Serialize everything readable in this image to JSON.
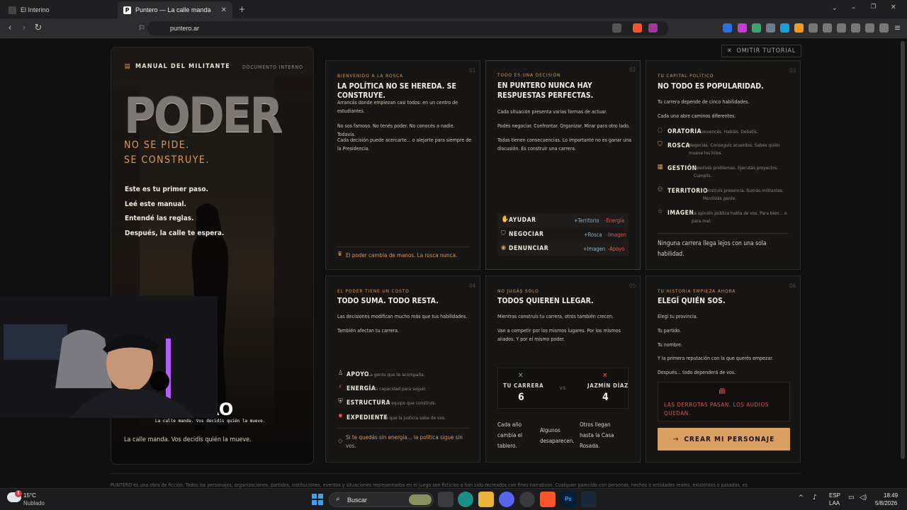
{
  "browser": {
    "tabs": [
      {
        "label": "El Interino"
      },
      {
        "label": "Puntero — La calle manda"
      }
    ],
    "url": "puntero.ar"
  },
  "skip_button": "OMITIR TUTORIAL",
  "manual": {
    "header": "MANUAL DEL MILITANTE",
    "doc_label": "DOCUMENTO INTERNO",
    "big_word": "PODER",
    "tagline_1": "NO SE PIDE.",
    "tagline_2": "SE CONSTRUYE.",
    "lines": [
      "Este es tu primer paso.",
      "Leé este manual.",
      "Entendé las reglas.",
      "Después, la calle te espera."
    ],
    "logo_text": "ERO",
    "logo_sub": "La calle manda. Vos decidís quién la mueve.",
    "footer": "La calle manda. Vos decidís quién la mueve."
  },
  "cards": {
    "c1": {
      "kicker": "BIENVENIDO A LA ROSCA",
      "num": "01",
      "title": "LA POLÍTICA NO SE HEREDA. SE CONSTRUYE.",
      "paras": [
        "Arrancás donde empiezan casi todos: en un centro de estudiantes.",
        "No sos famoso. No tenés poder. No conocés a nadie. Todavía.",
        "Cada decisión puede acercarte... o alejarte para siempre de la Presidencia."
      ],
      "footer": "El poder cambia de manos. La rosca nunca."
    },
    "c2": {
      "kicker": "TODO ES UNA DECISIÓN",
      "num": "02",
      "title_1": "EN PUNTERO NUNCA HAY",
      "title_2": "RESPUESTAS PERFECTAS.",
      "paras": [
        "Cada situación presenta varias formas de actuar.",
        "Podés negociar. Confrontar. Organizar. Mirar para otro lado.",
        "Todas tienen consecuencias. Lo importante no es ganar una discusión. Es construir una carrera."
      ],
      "actions": [
        {
          "name": "AYUDAR",
          "plus": "+Territorio",
          "minus": "-Energía"
        },
        {
          "name": "NEGOCIAR",
          "plus": "+Rosca",
          "minus": "-Imagen"
        },
        {
          "name": "DENUNCIAR",
          "plus": "+Imagen",
          "minus": "-Apoyo"
        }
      ]
    },
    "c3": {
      "kicker": "TU CAPITAL POLÍTICO",
      "num": "03",
      "title": "NO TODO ES POPULARIDAD.",
      "paras": [
        "Tu carrera depende de cinco habilidades.",
        "Cada una abre caminos diferentes."
      ],
      "skills": [
        {
          "name": "ORATORIA",
          "desc": "Convencés. Hablás. Debatís."
        },
        {
          "name": "ROSCA",
          "desc": "Negociás. Conseguís acuerdos. Sabés quién mueve los hilos."
        },
        {
          "name": "GESTIÓN",
          "desc": "Resolvés problemas. Ejecutás proyectos. Cumplís."
        },
        {
          "name": "TERRITORIO",
          "desc": "Construís presencia. Sumás militantes. Movilizás gente."
        },
        {
          "name": "IMAGEN",
          "desc": "La opinión pública habla de vos. Para bien... o para mal."
        }
      ],
      "footer": "Ninguna carrera llega lejos con una sola habilidad."
    },
    "c4": {
      "kicker": "EL PODER TIENE UN COSTO",
      "num": "04",
      "title": "TODO SUMA. TODO RESTA.",
      "paras": [
        "Las decisiones modifican mucho más que tus habilidades.",
        "También afectan tu carrera."
      ],
      "stats": [
        {
          "name": "APOYO",
          "desc": "La gente que te acompaña."
        },
        {
          "name": "ENERGÍA",
          "desc": "Tu capacidad para seguir."
        },
        {
          "name": "ESTRUCTURA",
          "desc": "El equipo que construís."
        },
        {
          "name": "EXPEDIENTE",
          "desc": "Lo que la justicia sabe de vos."
        }
      ],
      "footer": "Si te quedás sin energía... la política sigue sin vos."
    },
    "c5": {
      "kicker": "NO JUGÁS SOLO",
      "num": "05",
      "title": "TODOS QUIEREN LLEGAR.",
      "paras": [
        "Mientras construís tu carrera, otros también crecen.",
        "Van a competir por los mismos lugares. Por los mismos aliados. Y por el mismo poder."
      ],
      "versus": {
        "left_label": "TU CARRERA",
        "left_value": "6",
        "vs": "VS",
        "right_label": "JAZMÍN DÍAZ",
        "right_value": "4"
      },
      "cols": [
        "Cada año cambia el tablero.",
        "Algunos desaparecen.",
        "Otros llegan hasta la Casa Rosada."
      ]
    },
    "c6": {
      "kicker": "TU HISTORIA EMPIEZA AHORA",
      "num": "06",
      "title": "ELEGÍ QUIÉN SOS.",
      "paras": [
        "Elegí tu provincia.",
        "Tu partido.",
        "Tu nombre.",
        "Y la primera reputación con la que querés empezar.",
        "Después... todo dependerá de vos."
      ],
      "quote": "LAS DERROTAS PASAN. LOS AUDIOS QUEDAN.",
      "cta": "CREAR MI PERSONAJE"
    }
  },
  "disclaimer": "PUNTERO es una obra de ficción. Todos los personajes, organizaciones, partidos, instituciones, eventos y situaciones representados en el juego son ficticios o han sido recreados con fines narrativos. Cualquier parecido con personas, hechos o entidades reales, existentes o pasadas, es",
  "taskbar": {
    "weather_temp": "15°C",
    "weather_desc": "Nublado",
    "search": "Buscar",
    "lang_1": "ESP",
    "lang_2": "LAA",
    "time": "18:49",
    "date": "5/8/2026",
    "badge": "1"
  }
}
